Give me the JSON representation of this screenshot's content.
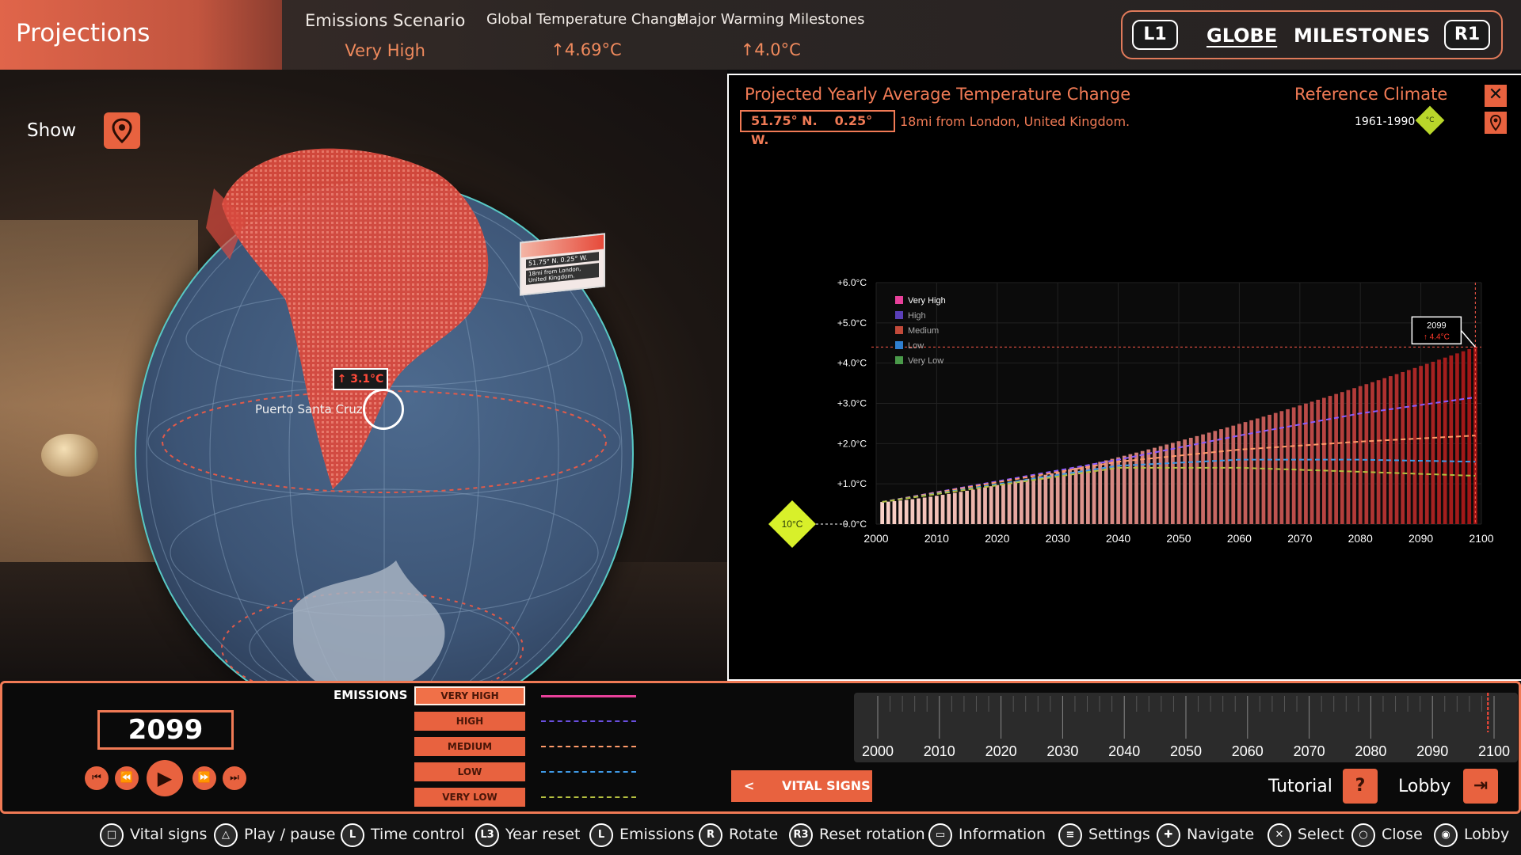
{
  "header": {
    "title": "Projections",
    "emissions_scenario_label": "Emissions Scenario",
    "emissions_scenario_value": "Very High",
    "global_temp_label": "Global Temperature Change",
    "global_temp_value": "↑4.69°C",
    "milestones_label": "Major Warming Milestones",
    "milestones_value": "↑4.0°C",
    "left_bumper": "L1",
    "right_bumper": "R1",
    "tabs": [
      {
        "label": "GLOBE",
        "active": true
      },
      {
        "label": "MILESTONES",
        "active": false
      }
    ]
  },
  "globe": {
    "show_label": "Show",
    "location_name": "Puerto Santa Cruz",
    "location_temp": "↑ 3.1°C",
    "mini_card_coords": "51.75° N.   0.25° W.",
    "mini_card_desc": "18mi from London, United Kingdom."
  },
  "panel": {
    "title": "Projected Yearly Average Temperature Change",
    "lat": "51.75° N.",
    "lon": "0.25° W.",
    "location_desc": "18mi from London, United Kingdom.",
    "reference_title": "Reference Climate",
    "reference_years": "1961-1990",
    "reference_unit": "°C",
    "close_icon": "✕"
  },
  "chart_data": {
    "type": "bar",
    "title": "Projected Yearly Average Temperature Change",
    "xlabel": "",
    "ylabel": "",
    "x_range": [
      2000,
      2100
    ],
    "x_ticks": [
      "2000",
      "2010",
      "2020",
      "2030",
      "2040",
      "2050",
      "2060",
      "2070",
      "2080",
      "2090",
      "2100"
    ],
    "y_range": [
      0,
      6
    ],
    "y_ticks": [
      "0.0°C",
      "+1.0°C",
      "+2.0°C",
      "+3.0°C",
      "+4.0°C",
      "+5.0°C",
      "+6.0°C"
    ],
    "reference_marker": "10°C",
    "legend_position": "top-left",
    "legend": [
      {
        "name": "Very High",
        "color": "#e8409a"
      },
      {
        "name": "High",
        "color": "#5a3fb8"
      },
      {
        "name": "Medium",
        "color": "#c24a3a"
      },
      {
        "name": "Low",
        "color": "#2f7fd0"
      },
      {
        "name": "Very Low",
        "color": "#4a9a4a"
      }
    ],
    "bars_series": "Very High",
    "bars": {
      "x_start": 2001,
      "x_end": 2099,
      "y_start": 0.55,
      "y_end": 4.4,
      "curve": 1.35
    },
    "series": [
      {
        "name": "High",
        "color": "#8a5cff",
        "points": [
          [
            2001,
            0.55
          ],
          [
            2040,
            1.6
          ],
          [
            2060,
            2.2
          ],
          [
            2080,
            2.75
          ],
          [
            2099,
            3.15
          ]
        ]
      },
      {
        "name": "Medium",
        "color": "#ff9a6a",
        "points": [
          [
            2001,
            0.55
          ],
          [
            2040,
            1.55
          ],
          [
            2060,
            1.85
          ],
          [
            2080,
            2.05
          ],
          [
            2099,
            2.2
          ]
        ]
      },
      {
        "name": "Low",
        "color": "#3f9be8",
        "points": [
          [
            2001,
            0.55
          ],
          [
            2040,
            1.45
          ],
          [
            2060,
            1.6
          ],
          [
            2080,
            1.6
          ],
          [
            2099,
            1.55
          ]
        ]
      },
      {
        "name": "Very Low",
        "color": "#b5c040",
        "points": [
          [
            2001,
            0.55
          ],
          [
            2040,
            1.4
          ],
          [
            2060,
            1.4
          ],
          [
            2080,
            1.3
          ],
          [
            2099,
            1.2
          ]
        ]
      }
    ],
    "selected_year": "2099",
    "selected_value": "↑ 4.4°C",
    "threshold": 4.4
  },
  "controls": {
    "year": "2099",
    "emissions_label": "EMISSIONS",
    "emissions_options": [
      {
        "label": "VERY HIGH",
        "active": true,
        "color": "#e8409a"
      },
      {
        "label": "HIGH",
        "active": false,
        "color": "#5a3fb8"
      },
      {
        "label": "MEDIUM",
        "active": false,
        "color": "#ff9a6a"
      },
      {
        "label": "LOW",
        "active": false,
        "color": "#3f9be8"
      },
      {
        "label": "VERY LOW",
        "active": false,
        "color": "#b5c040"
      }
    ],
    "timeline_ticks": [
      "2000",
      "2010",
      "2020",
      "2030",
      "2040",
      "2050",
      "2060",
      "2070",
      "2080",
      "2090",
      "2100"
    ],
    "timeline_position": 2099,
    "vital_signs_arrow": "<",
    "vital_signs_label": "VITAL SIGNS",
    "tutorial_label": "Tutorial",
    "lobby_label": "Lobby"
  },
  "hints": [
    {
      "icon": "□",
      "label": "Vital signs",
      "icon_name": "square-button-icon"
    },
    {
      "icon": "△",
      "label": "Play / pause",
      "icon_name": "triangle-button-icon"
    },
    {
      "icon": "L",
      "label": "Time control",
      "icon_name": "left-stick-icon"
    },
    {
      "icon": "L3",
      "label": "Year reset",
      "icon_name": "l3-button-icon"
    },
    {
      "icon": "L",
      "label": "Emissions",
      "icon_name": "left-stick-vertical-icon"
    },
    {
      "icon": "R",
      "label": "Rotate",
      "icon_name": "right-stick-icon"
    },
    {
      "icon": "R3",
      "label": "Reset rotation",
      "icon_name": "r3-button-icon"
    },
    {
      "icon": "▭",
      "label": "Information",
      "icon_name": "touchpad-icon"
    },
    {
      "icon": "≡",
      "label": "Settings",
      "icon_name": "options-button-icon"
    },
    {
      "icon": "✚",
      "label": "Navigate",
      "icon_name": "dpad-icon"
    },
    {
      "icon": "✕",
      "label": "Select",
      "icon_name": "cross-button-icon"
    },
    {
      "icon": "○",
      "label": "Close",
      "icon_name": "circle-button-icon"
    },
    {
      "icon": "◉",
      "label": "Lobby",
      "icon_name": "ps-button-icon"
    }
  ]
}
